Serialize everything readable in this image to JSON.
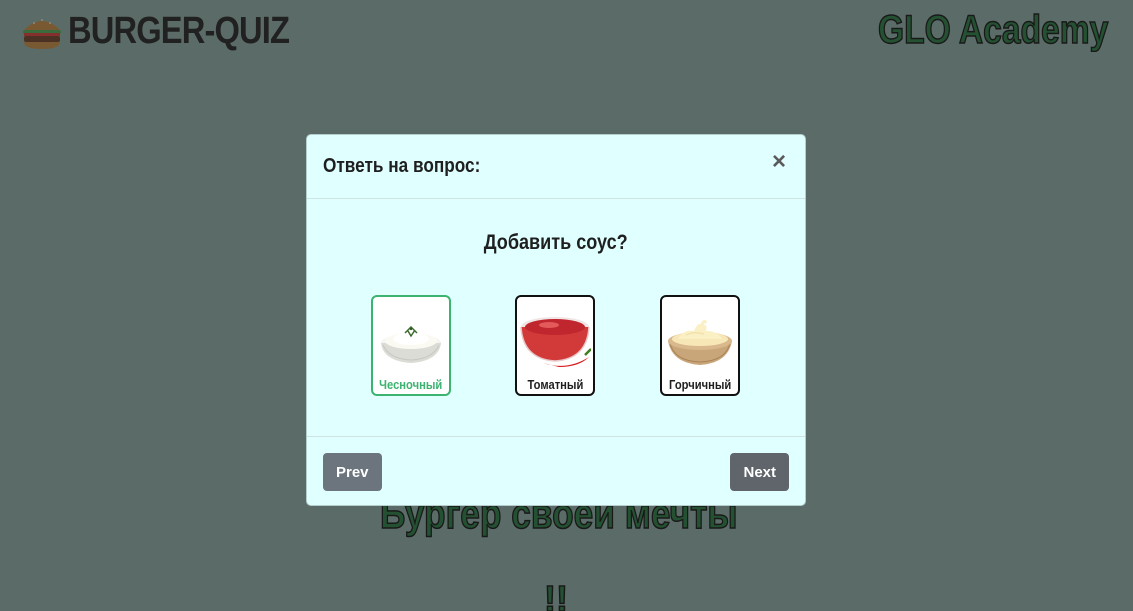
{
  "header": {
    "logo_text": "BURGER-QUIZ",
    "academy_text": "GLO Academy",
    "logo_icon": "burger-icon"
  },
  "background": {
    "tagline": "Бургер своей мечты",
    "fragment": "!!"
  },
  "modal": {
    "title": "Ответь на вопрос:",
    "close_label": "×",
    "question": "Добавить соус?",
    "options": [
      {
        "label": "Чесночный",
        "selected": true,
        "icon": "garlic-sauce-bowl"
      },
      {
        "label": "Томатный",
        "selected": false,
        "icon": "tomato-sauce-bowl"
      },
      {
        "label": "Горчичный",
        "selected": false,
        "icon": "mustard-sauce-bowl"
      }
    ],
    "prev_label": "Prev",
    "next_label": "Next"
  },
  "colors": {
    "accent": "#3cb371",
    "modal_bg": "#e0ffff",
    "button_bg": "#6c757d",
    "academy_green": "#1e7a3c"
  }
}
